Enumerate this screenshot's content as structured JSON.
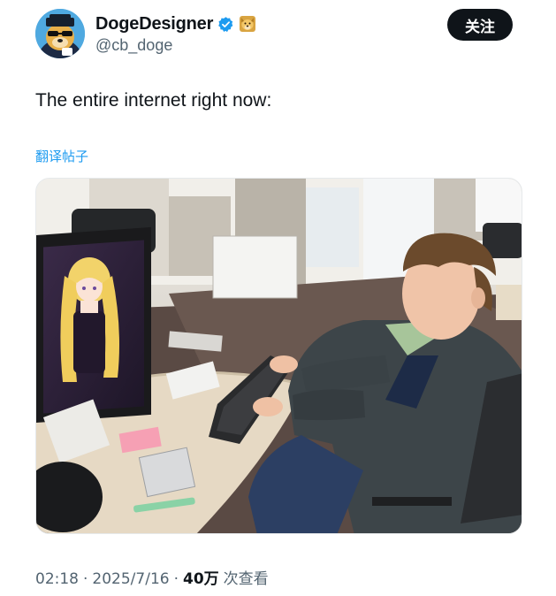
{
  "author": {
    "display_name": "DogeDesigner",
    "handle": "@cb_doge",
    "verified": true,
    "badge_icon": "doge-emoji-icon",
    "avatar": "doge-avatar"
  },
  "follow_button": {
    "label": "关注"
  },
  "tweet": {
    "text": "The entire internet right now:",
    "translate_label": "翻译帖子"
  },
  "media": {
    "description_icon": "photo",
    "subject": "man-at-computer-with-anime-character-on-monitor"
  },
  "meta": {
    "time": "02:18",
    "separator": "·",
    "date": "2025/7/16",
    "views_count": "40万",
    "views_label": "次查看"
  },
  "colors": {
    "accent": "#1d9bf0",
    "text": "#0f1419",
    "secondary": "#536471",
    "button_bg": "#0f1419"
  }
}
